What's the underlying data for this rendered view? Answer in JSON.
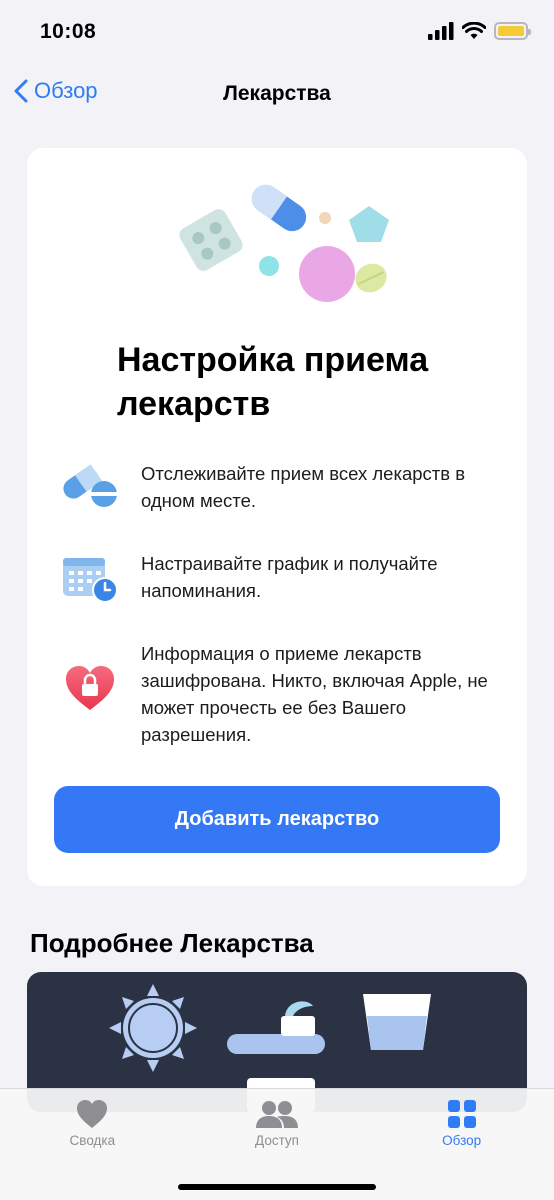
{
  "status_bar": {
    "time": "10:08",
    "battery_color": "#f4cb36"
  },
  "nav": {
    "back_label": "Обзор",
    "title": "Лекарства"
  },
  "setup_card": {
    "title": "Настройка приема лекарств",
    "features": [
      {
        "icon": "pills-icon",
        "text": "Отслеживайте прием всех лекарств в одном месте."
      },
      {
        "icon": "calendar-clock-icon",
        "text": "Настраивайте график и получайте напоминания."
      },
      {
        "icon": "heart-lock-icon",
        "text": "Информация о приеме лекарств зашифрована. Никто, включая Apple, не может прочесть ее без Вашего разрешения."
      }
    ],
    "button_label": "Добавить лекарство"
  },
  "section": {
    "title": "Подробнее Лекарства"
  },
  "tab_bar": {
    "tabs": [
      {
        "label": "Сводка",
        "icon": "heart-icon",
        "active": false
      },
      {
        "label": "Доступ",
        "icon": "people-icon",
        "active": false
      },
      {
        "label": "Обзор",
        "icon": "grid-icon",
        "active": true
      }
    ]
  },
  "colors": {
    "accent": "#3478f6",
    "background": "#f2f2f7",
    "inactive_tab": "#8e8e93"
  }
}
